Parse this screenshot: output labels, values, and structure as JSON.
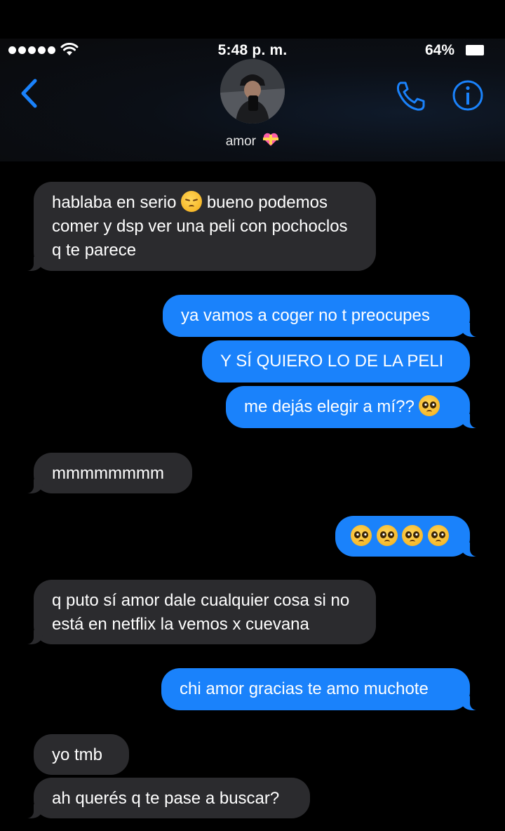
{
  "status_bar": {
    "time": "5:48 p. m.",
    "battery_percent": "64%",
    "signal_bars": 5
  },
  "header": {
    "contact_name": "amor",
    "back_icon": "chevron-left-icon",
    "call_icon": "phone-icon",
    "info_icon": "info-icon"
  },
  "colors": {
    "incoming_bubble": "#2b2b2e",
    "outgoing_bubble": "#1a82fb",
    "accent": "#1a82fb"
  },
  "messages": [
    {
      "dir": "in",
      "text_before": "hablaba en serio",
      "text_after": "bueno podemos comer y dsp ver una peli con pochoclos q te parece",
      "emoji": "pensive-face"
    },
    {
      "dir": "out",
      "text": "ya vamos a coger no t preocupes"
    },
    {
      "dir": "out",
      "text": "Y SÍ QUIERO LO DE LA PELI"
    },
    {
      "dir": "out",
      "text": "me dejás elegir a mí??",
      "emoji": "pleading-face"
    },
    {
      "dir": "in",
      "text": "mmmmmmmm"
    },
    {
      "dir": "out",
      "text": "",
      "emoji": "pleading-face x4"
    },
    {
      "dir": "in",
      "text": "q puto sí amor dale cualquier cosa si no está en netflix la vemos x cuevana"
    },
    {
      "dir": "out",
      "text": "chi amor gracias te amo muchote"
    },
    {
      "dir": "in",
      "text": "yo tmb"
    },
    {
      "dir": "in",
      "text": "ah querés q te pase a buscar?"
    }
  ]
}
